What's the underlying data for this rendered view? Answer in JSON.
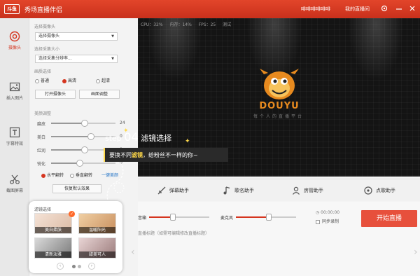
{
  "titlebar": {
    "logo_text": "斗鱼",
    "app_title": "秀场直播伴侣",
    "user_link": "啡啡啡啡啡啡",
    "live_link": "我的直播间",
    "accent": "#d5351f"
  },
  "sidebar": {
    "items": [
      {
        "label": "摄像头",
        "icon": "camera-icon",
        "active": true
      },
      {
        "label": "插入图片",
        "icon": "image-icon",
        "active": false
      },
      {
        "label": "字幕特效",
        "icon": "text-icon",
        "active": false
      },
      {
        "label": "截图屏幕",
        "icon": "scissors-icon",
        "active": false
      }
    ]
  },
  "controls": {
    "camera_label": "选择摄像头",
    "camera_select": "选择摄像头",
    "resolution_label": "选择采集大小",
    "resolution_select": "选择采集分辨率...",
    "quality_label": "画质选择",
    "quality_options": [
      "普通",
      "高清",
      "超清"
    ],
    "quality_selected": "高清",
    "open_camera_btn": "打开摄像头",
    "adjust_btn": "画面调整",
    "beauty_label": "美颜调整",
    "sliders": [
      {
        "label": "磨皮",
        "value": 24,
        "level": 0.52
      },
      {
        "label": "美白",
        "value": 0,
        "level": 0.62
      },
      {
        "label": "红润",
        "value": 0,
        "level": 0.52
      },
      {
        "label": "锐化",
        "value": 0,
        "level": 0.45
      }
    ],
    "mirror_option": "水平翻转",
    "flip_option": "垂直翻转",
    "more_link": "一键美颜",
    "restore_btn": "恢复默认效果"
  },
  "preview": {
    "cpu": "CPU：32%",
    "memory": "内存：14%",
    "fps": "FPS：25",
    "extra": "测试",
    "brand": "DOUYU",
    "slogan": "每个人的直播平台"
  },
  "assistants": [
    {
      "label": "弹幕助手",
      "icon": "danmaku-icon"
    },
    {
      "label": "歌名助手",
      "icon": "music-icon"
    },
    {
      "label": "房管助手",
      "icon": "user-icon"
    },
    {
      "label": "点歌助手",
      "icon": "disc-icon"
    }
  ],
  "audio": {
    "speaker_label": "音箱",
    "speaker_level": 0.4,
    "mic_label": "麦克风",
    "mic_level": 0.55,
    "timer": "00:00:00",
    "record_label": "同步录制"
  },
  "start_button": "开始直播",
  "live_title_hint": "直播标题（如需可编辑修改直播标题）",
  "tip": {
    "step_prefix": "step",
    "step_number": "04",
    "step_title": "滤镜选择",
    "text_before": "要换不同",
    "text_highlight": "滤镜",
    "text_after": "，给粉丝不一样的你~"
  },
  "filter_panel": {
    "title": "滤镜选择",
    "filters": [
      {
        "label": "美白柔肤",
        "selected": true
      },
      {
        "label": "温暖阳光",
        "selected": false
      },
      {
        "label": "清新淡雅",
        "selected": false
      },
      {
        "label": "甜美可人",
        "selected": false
      }
    ],
    "current_page": 1,
    "total_pages": 2
  }
}
